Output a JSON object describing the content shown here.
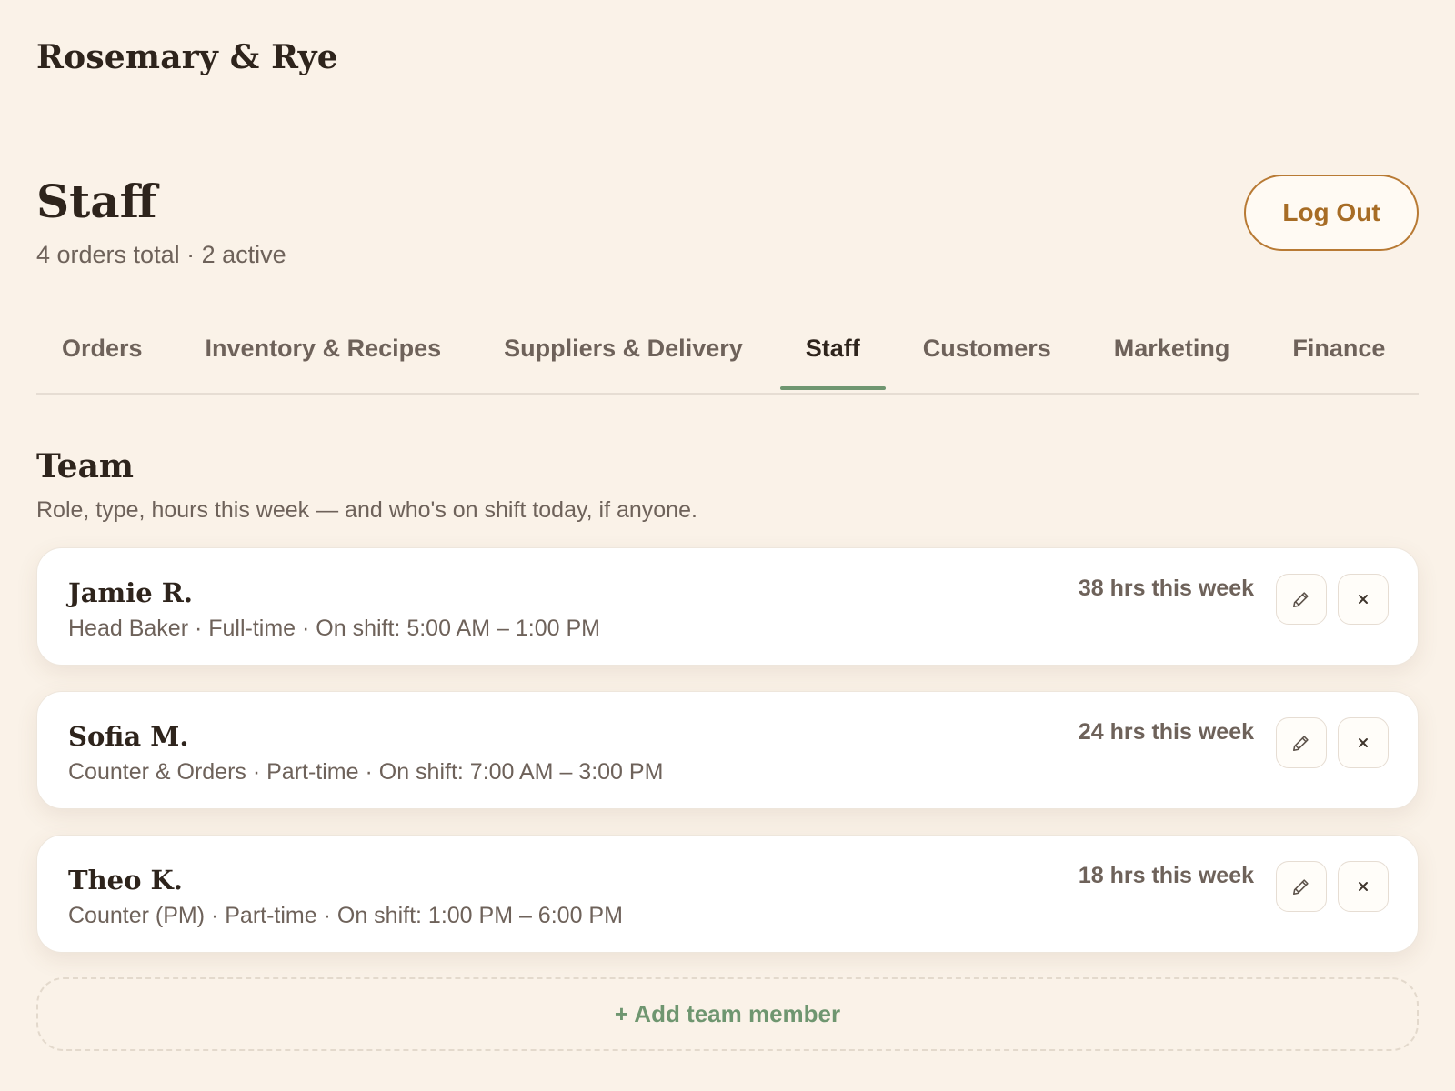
{
  "brand": "Rosemary & Rye",
  "header": {
    "title": "Staff",
    "subtitle": "4 orders total · 2 active",
    "logout_label": "Log Out"
  },
  "tabs": [
    {
      "label": "Orders",
      "active": false
    },
    {
      "label": "Inventory & Recipes",
      "active": false
    },
    {
      "label": "Suppliers & Delivery",
      "active": false
    },
    {
      "label": "Staff",
      "active": true
    },
    {
      "label": "Customers",
      "active": false
    },
    {
      "label": "Marketing",
      "active": false
    },
    {
      "label": "Finance",
      "active": false
    }
  ],
  "team": {
    "title": "Team",
    "description": "Role, type, hours this week — and who's on shift today, if anyone.",
    "members": [
      {
        "name": "Jamie R.",
        "details": "Head Baker · Full-time · On shift: 5:00 AM – 1:00 PM",
        "hours": "38 hrs this week",
        "edit_icon": "pencil-icon",
        "remove_icon": "close-icon"
      },
      {
        "name": "Sofia M.",
        "details": "Counter & Orders · Part-time · On shift: 7:00 AM – 3:00 PM",
        "hours": "24 hrs this week",
        "edit_icon": "pencil-icon",
        "remove_icon": "close-icon"
      },
      {
        "name": "Theo K.",
        "details": "Counter (PM) · Part-time · On shift: 1:00 PM – 6:00 PM",
        "hours": "18 hrs this week",
        "edit_icon": "pencil-icon",
        "remove_icon": "close-icon"
      }
    ],
    "add_label": "+ Add team member"
  },
  "colors": {
    "background": "#faf2e8",
    "accent_green": "#6f9670",
    "accent_brown": "#a76c25",
    "text_dark": "#2e241c",
    "text_muted": "#6e625a"
  }
}
